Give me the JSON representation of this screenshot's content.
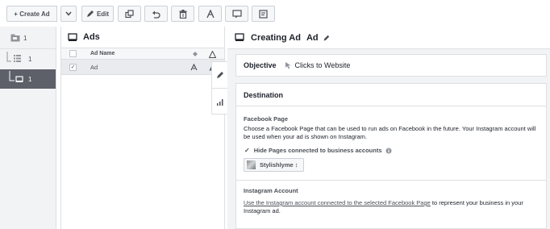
{
  "toolbar": {
    "create_ad_label": "+ Create Ad",
    "edit_label": "Edit"
  },
  "tree": {
    "items": [
      {
        "icon": "campaign-icon",
        "count": "1"
      },
      {
        "icon": "adset-icon",
        "count": "1"
      },
      {
        "icon": "ad-icon",
        "count": "1"
      }
    ]
  },
  "ads_panel": {
    "title": "Ads",
    "column_header": "Ad Name",
    "rows": [
      {
        "name": "Ad",
        "checked": true
      }
    ]
  },
  "editor": {
    "title": "Creating Ad",
    "subtitle": "Ad",
    "objective_label": "Objective",
    "objective_value": "Clicks to Website",
    "destination_title": "Destination",
    "facebook_page_label": "Facebook Page",
    "facebook_page_text": "Choose a Facebook Page that can be used to run ads on Facebook in the future. Your Instagram account will be used when your ad is shown on Instagram.",
    "hide_pages_label": "Hide Pages connected to business accounts",
    "page_select_value": "Stylishlyme ↕",
    "instagram_label": "Instagram Account",
    "instagram_link": "Use the Instagram account connected to the selected Facebook Page",
    "instagram_rest": " to represent your business in your Instagram ad."
  }
}
